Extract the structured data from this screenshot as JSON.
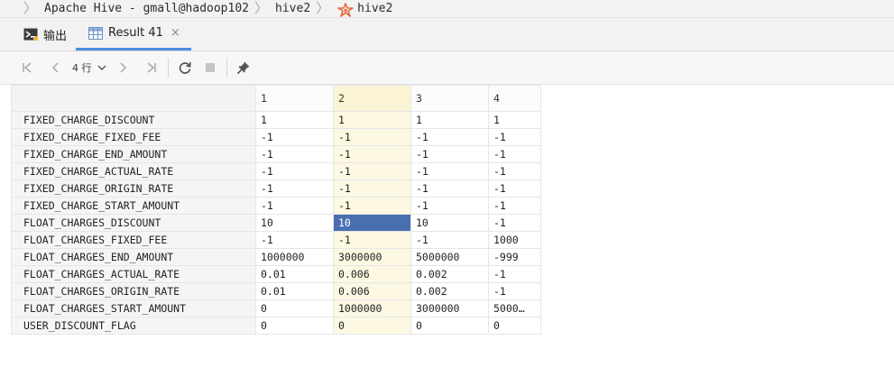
{
  "breadcrumb": {
    "items": [
      "Apache Hive - gmall@hadoop102",
      "hive2",
      "hive2"
    ]
  },
  "tabs": [
    {
      "label": "输出",
      "icon": "console-output-icon"
    },
    {
      "label": "Result 41",
      "icon": "table-grid-icon",
      "close": "×"
    }
  ],
  "toolbar": {
    "row_count": "4 行"
  },
  "grid": {
    "columns": [
      "1",
      "2",
      "3",
      "4"
    ],
    "rows": [
      {
        "name": "FIXED_CHARGE_DISCOUNT",
        "values": [
          "1",
          "1",
          "1",
          "1"
        ]
      },
      {
        "name": "FIXED_CHARGE_FIXED_FEE",
        "values": [
          "-1",
          "-1",
          "-1",
          "-1"
        ]
      },
      {
        "name": "FIXED_CHARGE_END_AMOUNT",
        "values": [
          "-1",
          "-1",
          "-1",
          "-1"
        ]
      },
      {
        "name": "FIXED_CHARGE_ACTUAL_RATE",
        "values": [
          "-1",
          "-1",
          "-1",
          "-1"
        ]
      },
      {
        "name": "FIXED_CHARGE_ORIGIN_RATE",
        "values": [
          "-1",
          "-1",
          "-1",
          "-1"
        ]
      },
      {
        "name": "FIXED_CHARGE_START_AMOUNT",
        "values": [
          "-1",
          "-1",
          "-1",
          "-1"
        ]
      },
      {
        "name": "FLOAT_CHARGES_DISCOUNT",
        "values": [
          "10",
          "10",
          "10",
          "-1"
        ]
      },
      {
        "name": "FLOAT_CHARGES_FIXED_FEE",
        "values": [
          "-1",
          "-1",
          "-1",
          "1000"
        ]
      },
      {
        "name": "FLOAT_CHARGES_END_AMOUNT",
        "values": [
          "1000000",
          "3000000",
          "5000000",
          "-999"
        ]
      },
      {
        "name": "FLOAT_CHARGES_ACTUAL_RATE",
        "values": [
          "0.01",
          "0.006",
          "0.002",
          "-1"
        ]
      },
      {
        "name": "FLOAT_CHARGES_ORIGIN_RATE",
        "values": [
          "0.01",
          "0.006",
          "0.002",
          "-1"
        ]
      },
      {
        "name": "FLOAT_CHARGES_START_AMOUNT",
        "values": [
          "0",
          "1000000",
          "3000000",
          "5000…"
        ]
      },
      {
        "name": "USER_DISCOUNT_FLAG",
        "values": [
          "0",
          "0",
          "0",
          "0"
        ]
      }
    ]
  },
  "colors": {
    "selected_cell": "#4a6fb0",
    "selected_column": "#fdf8e2",
    "active_tab_underline": "#4d8de5",
    "hive_icon": "#e8663d"
  }
}
